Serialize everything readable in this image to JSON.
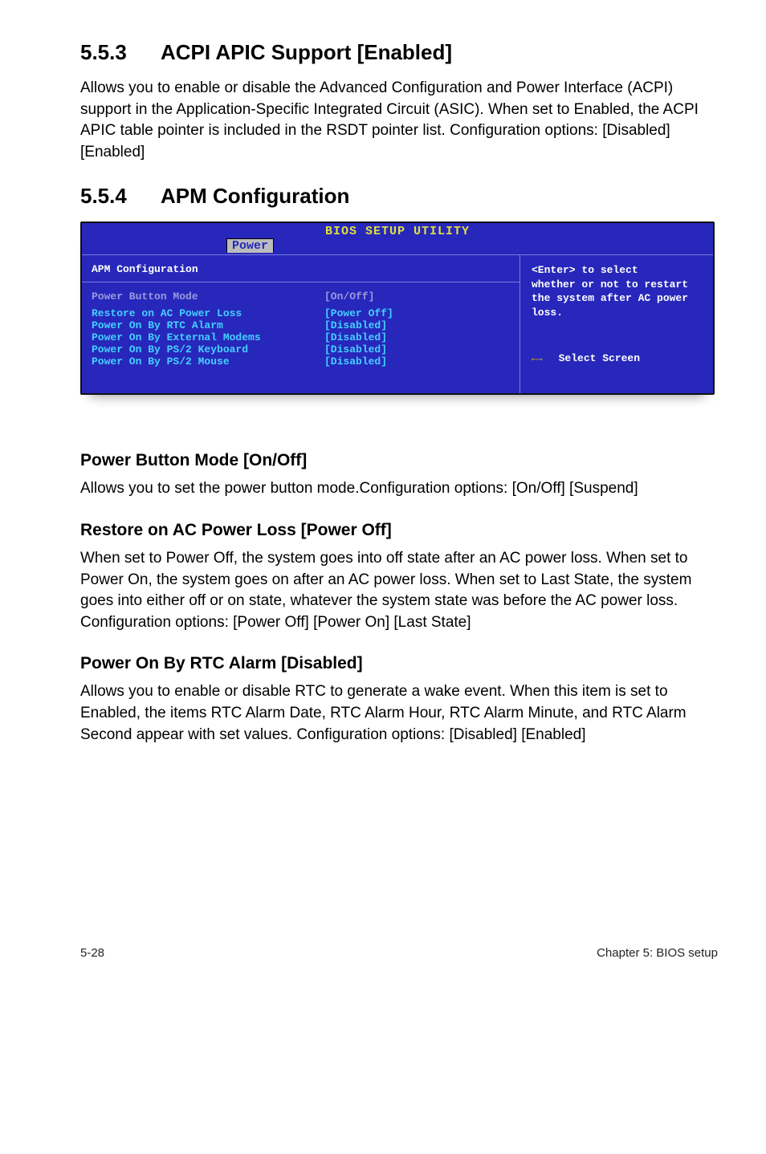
{
  "section1": {
    "num": "5.5.3",
    "title": "ACPI APIC Support [Enabled]",
    "body": "Allows you to enable or disable the Advanced Configuration and Power Interface (ACPI) support in the Application-Specific Integrated Circuit (ASIC). When set to Enabled, the ACPI APIC table pointer is included in the RSDT pointer list. Configuration options: [Disabled] [Enabled]"
  },
  "section2": {
    "num": "5.5.4",
    "title": "APM Configuration"
  },
  "bios": {
    "title": "BIOS SETUP UTILITY",
    "tab": "Power",
    "cfg_title": "APM Configuration",
    "rows": [
      {
        "label": "Power Button Mode",
        "val": "[On/Off]"
      },
      {
        "label": "Restore on AC Power Loss",
        "val": "[Power Off]"
      },
      {
        "label": "Power On By RTC Alarm",
        "val": "[Disabled]"
      },
      {
        "label": "Power On By External Modems",
        "val": "[Disabled]"
      },
      {
        "label": "Power On By PS/2 Keyboard",
        "val": "[Disabled]"
      },
      {
        "label": "Power On By PS/2 Mouse",
        "val": "[Disabled]"
      }
    ],
    "help1": "<Enter> to select",
    "help2": "whether or not to restart the system after AC power loss.",
    "nav_arrows": "←→",
    "nav_text": "Select Screen"
  },
  "sub1": {
    "heading": "Power Button Mode [On/Off]",
    "body": "Allows you to set the power button mode.Configuration options: [On/Off] [Suspend]"
  },
  "sub2": {
    "heading": "Restore on AC Power Loss [Power Off]",
    "body": "When set to Power Off, the system goes into off state after an AC power loss. When set to Power On, the system goes on after an AC power loss. When set to Last State, the system goes into either off or on state, whatever the system state was before the AC power loss. Configuration options: [Power Off] [Power On] [Last State]"
  },
  "sub3": {
    "heading": "Power On By RTC Alarm [Disabled]",
    "body": "Allows you to enable or disable RTC to generate a wake event. When this item is set to Enabled, the items RTC Alarm Date, RTC Alarm Hour, RTC Alarm Minute, and RTC Alarm Second appear with set values. Configuration options: [Disabled] [Enabled]"
  },
  "footer": {
    "left": "5-28",
    "right": "Chapter 5: BIOS setup"
  }
}
